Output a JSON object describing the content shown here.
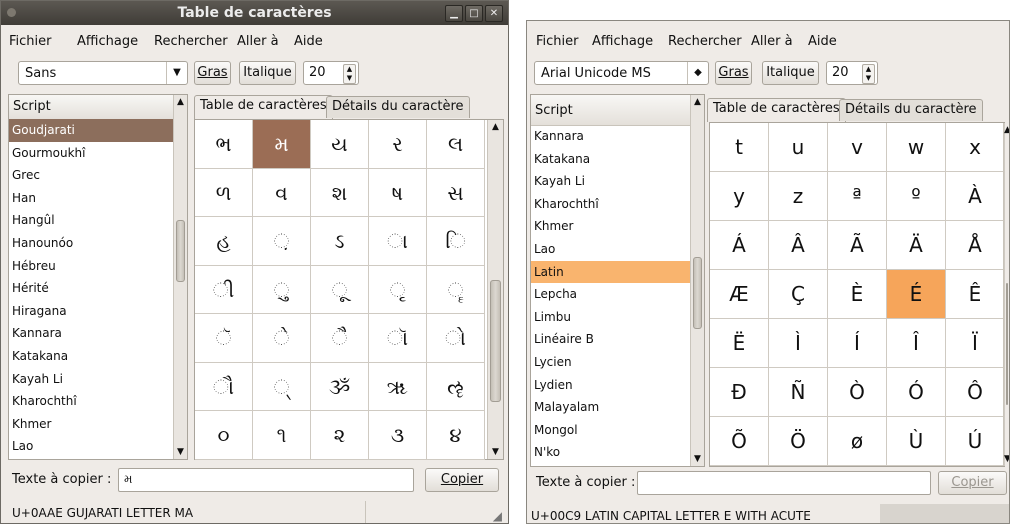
{
  "w1": {
    "title": "Table de caractères",
    "menu": [
      "Fichier",
      "Affichage",
      "Rechercher",
      "Aller à",
      "Aide"
    ],
    "font": "Sans",
    "bold_label": "Gras",
    "italic_label": "Italique",
    "size": "20",
    "script_header": "Script",
    "scripts": [
      "Goudjarati",
      "Gourmoukhî",
      "Grec",
      "Han",
      "Hangûl",
      "Hanounóo",
      "Hébreu",
      "Hérité",
      "Hiragana",
      "Kannara",
      "Katakana",
      "Kayah Li",
      "Kharochthî",
      "Khmer",
      "Lao"
    ],
    "selected_script": 0,
    "tab_table": "Table de caractères",
    "tab_details": "Détails du caractère",
    "cells": [
      [
        "ભ",
        "મ",
        "ય",
        "ર",
        "લ"
      ],
      [
        "ળ",
        "વ",
        "શ",
        "ષ",
        "સ"
      ],
      [
        "હ",
        "઼",
        "ઽ",
        "ા",
        "િ"
      ],
      [
        "ી",
        "ુ",
        "ૂ",
        "ૃ",
        "ૄ"
      ],
      [
        "ૅ",
        "ે",
        "ૈ",
        "ૉ",
        "ો"
      ],
      [
        "ૌ",
        "્",
        "ૐ",
        "ૠ",
        "ૡ"
      ],
      [
        "૦",
        "૧",
        "૨",
        "૩",
        "૪"
      ]
    ],
    "selected_cell": [
      0,
      1
    ],
    "text_label": "Texte à copier :",
    "text_value": "મ",
    "copy_label": "Copier",
    "status": "U+0AAE GUJARATI LETTER MA"
  },
  "w2": {
    "menu": [
      "Fichier",
      "Affichage",
      "Rechercher",
      "Aller à",
      "Aide"
    ],
    "font": "Arial Unicode MS",
    "bold_label": "Gras",
    "italic_label": "Italique",
    "size": "20",
    "script_header": "Script",
    "scripts": [
      "Kannara",
      "Katakana",
      "Kayah Li",
      "Kharochthî",
      "Khmer",
      "Lao",
      "Latin",
      "Lepcha",
      "Limbu",
      "Linéaire B",
      "Lycien",
      "Lydien",
      "Malayalam",
      "Mongol",
      "N'ko"
    ],
    "selected_script": 6,
    "tab_table": "Table de caractères",
    "tab_details": "Détails du caractère",
    "cells": [
      [
        "t",
        "u",
        "v",
        "w",
        "x"
      ],
      [
        "y",
        "z",
        "ª",
        "º",
        "À"
      ],
      [
        "Á",
        "Â",
        "Ã",
        "Ä",
        "Å"
      ],
      [
        "Æ",
        "Ç",
        "È",
        "É",
        "Ê"
      ],
      [
        "Ë",
        "Ì",
        "Í",
        "Î",
        "Ï"
      ],
      [
        "Ð",
        "Ñ",
        "Ò",
        "Ó",
        "Ô"
      ],
      [
        "Õ",
        "Ö",
        "ø",
        "Ù",
        "Ú"
      ]
    ],
    "selected_cell": [
      3,
      3
    ],
    "text_label": "Texte à copier :",
    "text_value": "",
    "copy_label": "Copier",
    "status": "U+00C9 LATIN CAPITAL LETTER E WITH ACUTE"
  },
  "colors": {
    "w1_select": "#9b6d55",
    "w2_select": "#f6a55a",
    "w1_script_select": "#8c6e5c",
    "w2_script_select": "#f9b46e"
  }
}
